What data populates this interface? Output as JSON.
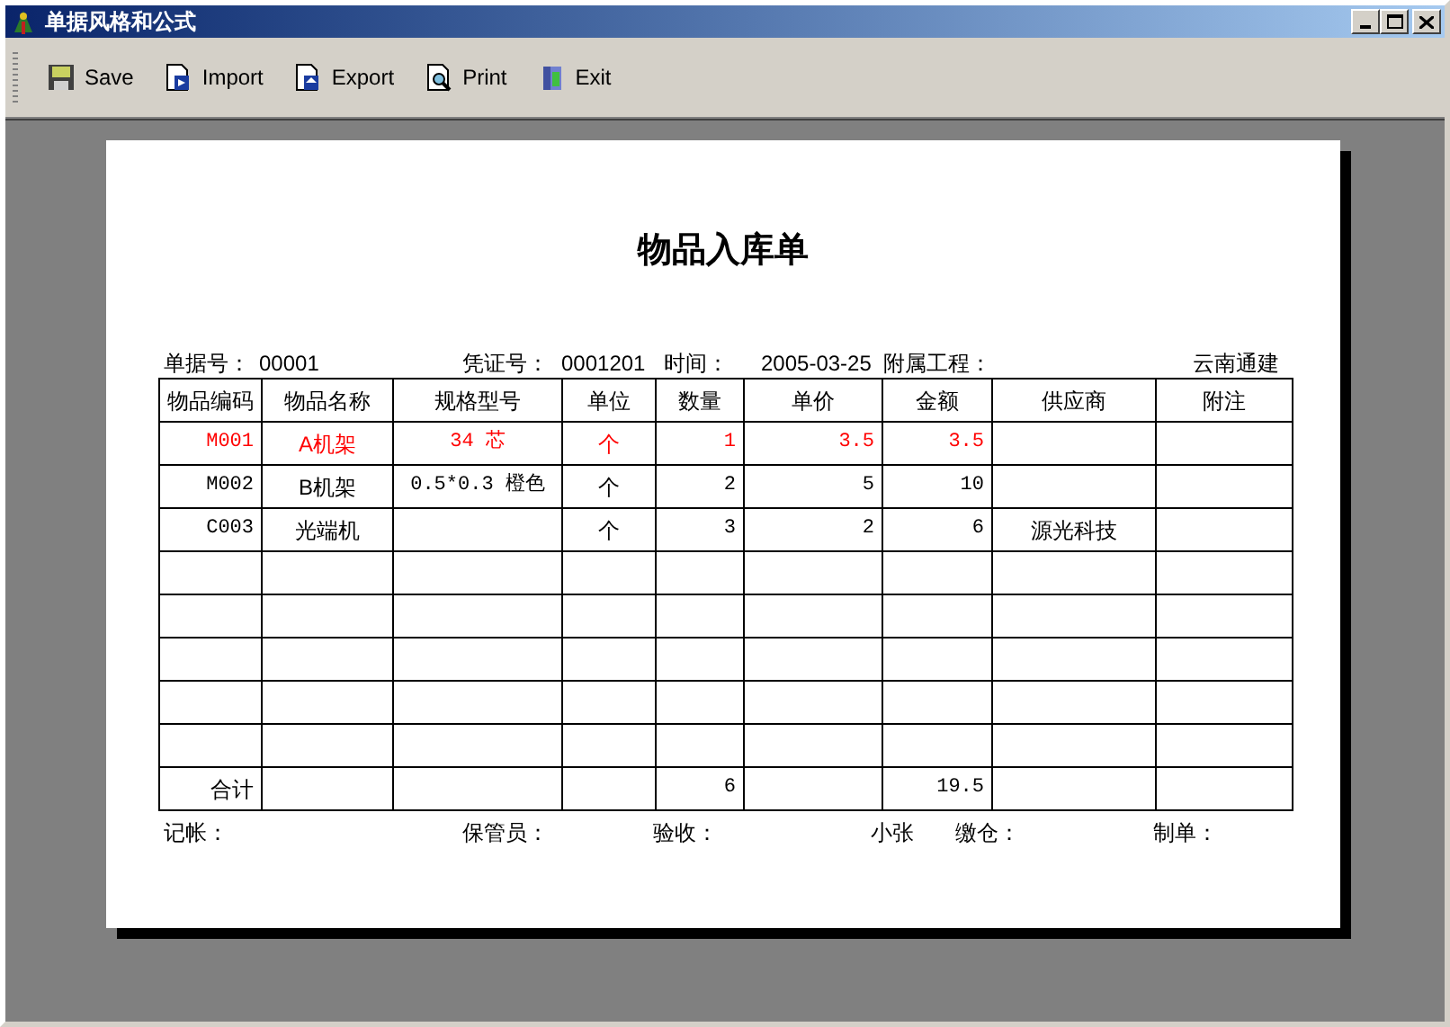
{
  "window": {
    "title": "单据风格和公式"
  },
  "toolbar": [
    {
      "label": "Save",
      "kind": "save"
    },
    {
      "label": "Import",
      "kind": "import"
    },
    {
      "label": "Export",
      "kind": "export"
    },
    {
      "label": "Print",
      "kind": "print"
    },
    {
      "label": "Exit",
      "kind": "exit"
    }
  ],
  "form": {
    "title": "物品入库单",
    "header": [
      "单据号：",
      "00001",
      "凭证号：",
      "0001201",
      "时间：",
      "2005-03-25",
      "附属工程：",
      "云南通建"
    ],
    "columns": [
      "物品编码",
      "物品名称",
      "规格型号",
      "单位",
      "数量",
      "单价",
      "金额",
      "供应商",
      "附注"
    ],
    "rows": [
      {
        "highlighted": true,
        "code": "M001",
        "name": "A机架",
        "spec": "34 芯",
        "unit": "个",
        "quantity": "1",
        "price": "3.5",
        "amount": "3.5"
      },
      {
        "highlighted": false,
        "code": "M002",
        "name": "B机架",
        "spec": "0.5*0.3 橙色",
        "unit": "个",
        "quantity": "2",
        "price": "5",
        "amount": "10"
      },
      {
        "highlighted": false,
        "code": "C003",
        "name": "光端机",
        "unit": "个",
        "quantity": "3",
        "price": "2",
        "amount": "6",
        "supplier": "源光科技"
      }
    ],
    "total_row": {
      "code": "合计",
      "quantity": "6",
      "amount": "19.5"
    },
    "footer": [
      "记帐：",
      "保管员：",
      "验收：",
      "小张",
      "缴仓：",
      "制单："
    ]
  }
}
